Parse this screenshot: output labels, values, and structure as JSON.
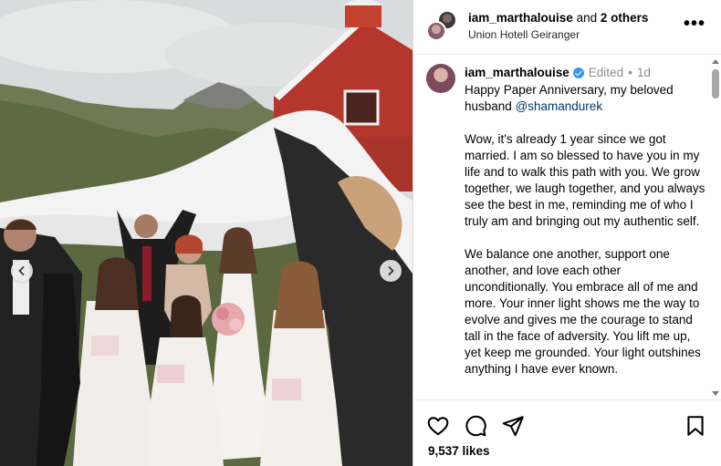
{
  "post": {
    "header": {
      "username": "iam_marthalouise",
      "connector": "and",
      "others": "2 others",
      "location": "Union Hotell Geiranger",
      "more_icon": "more-horizontal-icon"
    },
    "caption": {
      "username": "iam_marthalouise",
      "verified": true,
      "edited_label": "Edited",
      "separator": "•",
      "time": "1d",
      "line1": "Happy Paper Anniversary, my beloved husband ",
      "mention": "@shamandurek",
      "para2": "Wow, it's already 1 year since we got married. I am so blessed to have you in my life and to walk this path with you. We grow together, we laugh together, and you always see the best in me, reminding me of who I truly am and bringing out my authentic self.",
      "para3": "We balance one another, support one another, and love each other unconditionally. You embrace all of me and more. Your inner light shows me the way to evolve and gives me the courage to stand tall in the face of adversity. You lift me up, yet keep me grounded. Your light outshines anything I have ever known."
    },
    "actions": {
      "like_icon": "heart-icon",
      "comment_icon": "comment-icon",
      "share_icon": "send-icon",
      "save_icon": "bookmark-icon"
    },
    "likes_label": "9,537 likes",
    "carousel": {
      "prev_icon": "chevron-left-icon",
      "next_icon": "chevron-right-icon"
    },
    "colors": {
      "mention": "#00376b",
      "verified": "#3897f0",
      "muted": "#8e8e8e"
    }
  }
}
